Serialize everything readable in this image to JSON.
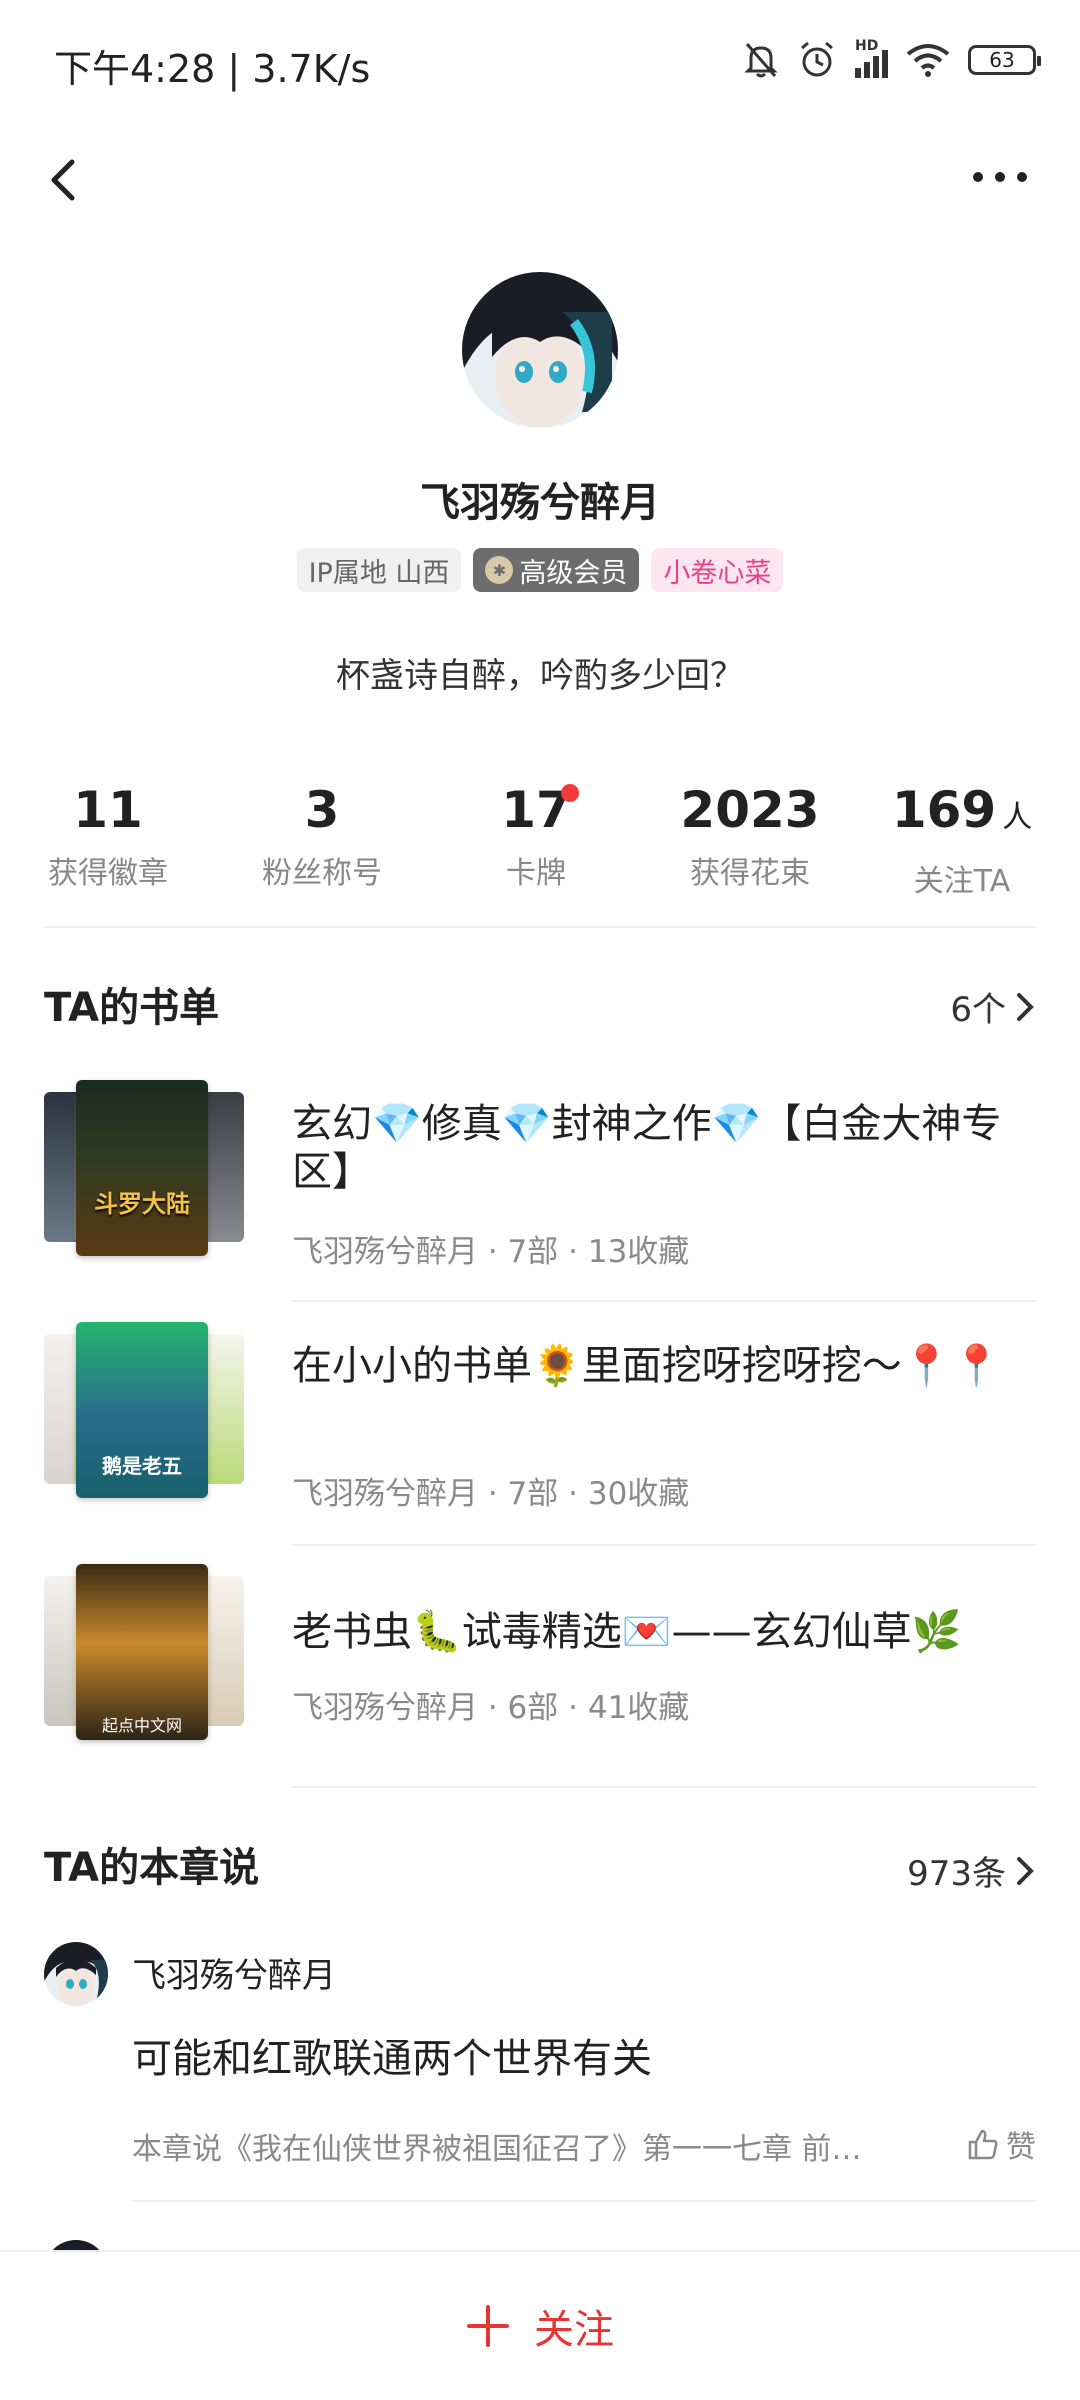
{
  "status_bar": {
    "time_speed": "下午4:28 | 3.7K/s",
    "network": "HD",
    "battery": "63"
  },
  "profile": {
    "nickname": "飞羽殇兮醉月",
    "ip_tag": "IP属地 山西",
    "vip_tag": "高级会员",
    "title_tag": "小卷心菜",
    "signature": "杯盏诗自醉，吟酌多少回？"
  },
  "stats": [
    {
      "value": "11",
      "unit": "",
      "label": "获得徽章"
    },
    {
      "value": "3",
      "unit": "",
      "label": "粉丝称号"
    },
    {
      "value": "17",
      "unit": "",
      "label": "卡牌"
    },
    {
      "value": "2023",
      "unit": "",
      "label": "获得花束"
    },
    {
      "value": "169",
      "unit": "人",
      "label": "关注TA"
    }
  ],
  "booklists": {
    "title": "TA的书单",
    "count": "6个",
    "items": [
      {
        "title": "玄幻💎修真💎封神之作💎【白金大神专区】",
        "meta": "飞羽殇兮醉月 · 7部 · 13收藏",
        "cover_text": "斗罗大陆"
      },
      {
        "title": "在小小的书单🌻里面挖呀挖呀挖～📍📍",
        "meta": "飞羽殇兮醉月 · 7部 · 30收藏",
        "cover_text": "鹅是老五"
      },
      {
        "title": "老书虫🐛试毒精选💌——玄幻仙草🌿",
        "meta": "飞羽殇兮醉月 · 6部 · 41收藏",
        "cover_text": "起点中文网"
      }
    ]
  },
  "chapter_comments": {
    "title": "TA的本章说",
    "count": "973条",
    "items": [
      {
        "user": "飞羽殇兮醉月",
        "text": "可能和红歌联通两个世界有关",
        "source": "本章说《我在仙侠世界被祖国征召了》第一一七章 前…",
        "like": "赞"
      }
    ]
  },
  "bottom": {
    "follow_label": "关注"
  },
  "colors": {
    "accent_red": "#e53535",
    "title_tag_text": "#e8438a"
  }
}
